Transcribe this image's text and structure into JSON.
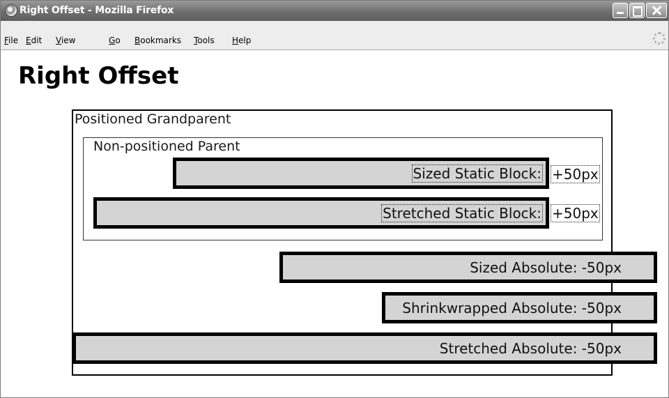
{
  "window": {
    "title": "Right Offset - Mozilla Firefox",
    "menu": [
      {
        "label": "File",
        "accel": "F",
        "rest": "ile"
      },
      {
        "label": "Edit",
        "accel": "E",
        "rest": "dit"
      },
      {
        "label": "View",
        "accel": "V",
        "rest": "iew"
      },
      {
        "label": "Go",
        "accel": "G",
        "rest": "o"
      },
      {
        "label": "Bookmarks",
        "accel": "B",
        "rest": "ookmarks"
      },
      {
        "label": "Tools",
        "accel": "T",
        "rest": "ools"
      },
      {
        "label": "Help",
        "accel": "H",
        "rest": "elp"
      }
    ]
  },
  "page": {
    "heading": "Right Offset",
    "grandparent_label": "Positioned Grandparent",
    "parent_label": "Non-positioned Parent",
    "blocks": {
      "sized_static": "Sized Static Block:",
      "sized_static_offset": "+50px",
      "stretched_static": "Stretched Static Block:",
      "stretched_static_offset": "+50px",
      "sized_absolute": "Sized Absolute: -50px",
      "shrinkwrapped_absolute": "Shrinkwrapped Absolute: -50px",
      "stretched_absolute": "Stretched Absolute: -50px"
    }
  },
  "colors": {
    "block_fill": "#d4d4d4",
    "block_border": "#000000",
    "titlebar": "#6f6f6f"
  }
}
